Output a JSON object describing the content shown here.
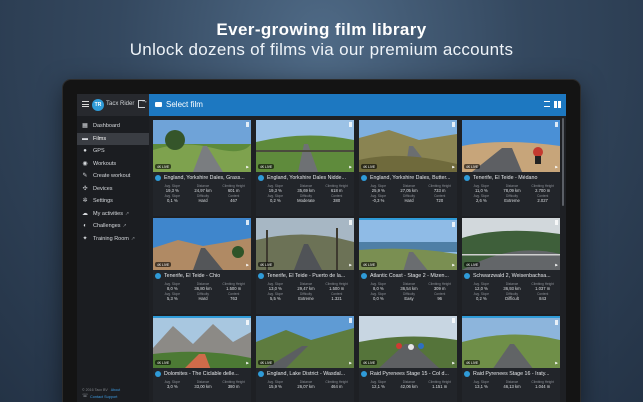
{
  "promo": {
    "title": "Ever-growing film library",
    "subtitle": "Unlock dozens of films via our premium accounts"
  },
  "app": {
    "brand": "Tacx Rider",
    "avatar_text": "TR",
    "header_title": "Select film",
    "accent": "#1d78c1"
  },
  "sidebar": {
    "items": [
      {
        "label": "Dashboard",
        "icon": "dashboard-icon",
        "glyph": "▦",
        "ext": ""
      },
      {
        "label": "Films",
        "icon": "film-icon",
        "glyph": "▬",
        "ext": ""
      },
      {
        "label": "GPS",
        "icon": "location-pin-icon",
        "glyph": "●",
        "ext": ""
      },
      {
        "label": "Workouts",
        "icon": "workouts-icon",
        "glyph": "◉",
        "ext": ""
      },
      {
        "label": "Create workout",
        "icon": "pencil-icon",
        "glyph": "✎",
        "ext": ""
      },
      {
        "label": "Devices",
        "icon": "devices-icon",
        "glyph": "✣",
        "ext": ""
      },
      {
        "label": "Settings",
        "icon": "gear-icon",
        "glyph": "✲",
        "ext": ""
      },
      {
        "label": "My activities",
        "icon": "activities-icon",
        "glyph": "☁",
        "ext": "↗"
      },
      {
        "label": "Challenges",
        "icon": "challenges-icon",
        "glyph": "◐",
        "ext": "↗"
      },
      {
        "label": "Training Room",
        "icon": "training-room-icon",
        "glyph": "✦",
        "ext": "↗"
      }
    ],
    "active_index": 1,
    "footer": "© 2016 Tacx BV",
    "about": "About",
    "support": "Contact Support"
  },
  "stat_labels": [
    "Avg. Slope",
    "Distance",
    "Climbing Height",
    "Avg. Slope",
    "Difficulty",
    "Content"
  ],
  "films": [
    {
      "title": "England, Yorkshire Dales, Grass...",
      "badge": "4K LIVE",
      "stats": [
        "19,3 %",
        "24,97 km",
        "601 m",
        "0,1 %",
        "Hard",
        "467"
      ],
      "scene": "dales1",
      "new": false
    },
    {
      "title": "England, Yorkshire Dales Nidde...",
      "badge": "4K LIVE",
      "stats": [
        "19,3 %",
        "35,69 km",
        "618 m",
        "0,2 %",
        "Moderate",
        "380"
      ],
      "scene": "dales2",
      "new": false
    },
    {
      "title": "England, Yorkshire Dales, Butter...",
      "badge": "4K LIVE",
      "stats": [
        "25,9 %",
        "27,05 km",
        "733 m",
        "-0,3 %",
        "Hard",
        "720"
      ],
      "scene": "dales3",
      "new": false
    },
    {
      "title": "Tenerife, El Teide - Médano",
      "badge": "4K LIVE",
      "stats": [
        "11,0 %",
        "78,09 km",
        "2.700 m",
        "2,6 %",
        "Extreme",
        "2.027"
      ],
      "scene": "teide1",
      "new": false
    },
    {
      "title": "Tenerife, El Teide - Chio",
      "badge": "4K LIVE",
      "stats": [
        "8,0 %",
        "36,80 km",
        "1.500 m",
        "5,3 %",
        "Hard",
        "763"
      ],
      "scene": "teide2",
      "new": false
    },
    {
      "title": "Tenerife, El Teide - Puerto de la...",
      "badge": "4K LIVE",
      "stats": [
        "13,0 %",
        "29,47 km",
        "1.500 m",
        "5,5 %",
        "Extreme",
        "1.321"
      ],
      "scene": "teide3",
      "new": false
    },
    {
      "title": "Atlantic Coast - Stage 2 - Mizen...",
      "badge": "4K LIVE",
      "stats": [
        "8,0 %",
        "36,54 km",
        "309 m",
        "0,0 %",
        "Easy",
        "96"
      ],
      "scene": "coast",
      "new": true
    },
    {
      "title": "Schwarzwald 2, Weisenbachsa...",
      "badge": "4K LIVE",
      "stats": [
        "12,0 %",
        "36,93 km",
        "1.037 m",
        "0,2 %",
        "Difficult",
        "843"
      ],
      "scene": "forest",
      "new": false
    },
    {
      "title": "Dolomites - The Ciclable delle...",
      "badge": "4K LIVE",
      "stats": [
        "3,0 %",
        "33,00 km",
        "380 m",
        "",
        "",
        ""
      ],
      "scene": "dolo",
      "new": true
    },
    {
      "title": "England, Lake District - Wasdal...",
      "badge": "4K LIVE",
      "stats": [
        "15,9 %",
        "26,07 km",
        "464 m",
        "",
        "",
        ""
      ],
      "scene": "lake",
      "new": false
    },
    {
      "title": "Raid Pyrenees Stage 15 - Col d...",
      "badge": "4K LIVE",
      "stats": [
        "12,1 %",
        "42,06 km",
        "1.151 m",
        "",
        "",
        ""
      ],
      "scene": "pyr1",
      "new": false
    },
    {
      "title": "Raid Pyrenees Stage 16 - Iraty...",
      "badge": "4K LIVE",
      "stats": [
        "13,1 %",
        "46,13 km",
        "1.044 m",
        "",
        "",
        ""
      ],
      "scene": "pyr2",
      "new": true
    }
  ]
}
